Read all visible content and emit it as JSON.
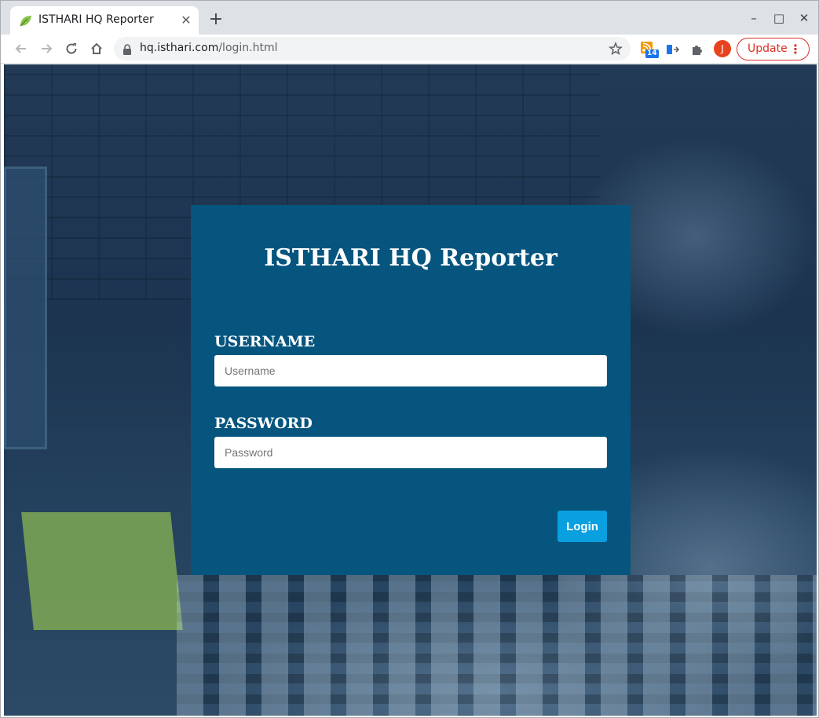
{
  "browser": {
    "tab_title": "ISTHARI HQ Reporter",
    "tab_close_glyph": "✕",
    "new_tab_glyph": "+",
    "url_host": "hq.isthari.com",
    "url_path": "/login.html",
    "extension_badge": "14",
    "profile_initial": "J",
    "update_label": "Update",
    "update_menu_glyph": "⋮",
    "minimize_glyph": "–",
    "maximize_glyph": "□",
    "close_glyph": "✕"
  },
  "login": {
    "title": "ISTHARI HQ Reporter",
    "username_label": "USERNAME",
    "username_placeholder": "Username",
    "password_label": "PASSWORD",
    "password_placeholder": "Password",
    "submit_label": "Login"
  },
  "colors": {
    "card_background": "#05557f",
    "login_button": "#0aa0e0",
    "update_accent": "#d93025",
    "avatar": "#e8421f"
  }
}
